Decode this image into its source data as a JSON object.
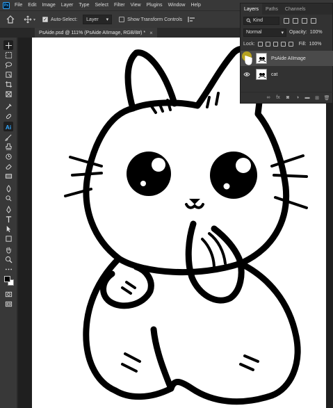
{
  "menubar": {
    "logo": "Ps",
    "items": [
      "File",
      "Edit",
      "Image",
      "Layer",
      "Type",
      "Select",
      "Filter",
      "View",
      "Plugins",
      "Window",
      "Help"
    ]
  },
  "options": {
    "auto_select_label": "Auto-Select:",
    "auto_select_checked": true,
    "target_value": "Layer",
    "transform_label": "Show Transform Controls",
    "transform_checked": false
  },
  "document": {
    "tab_title": "PsAide.psd @ 111% (PsAide AIImage, RGB/8#) *",
    "close_glyph": "×"
  },
  "layers_panel": {
    "tabs": [
      "Layers",
      "Paths",
      "Channels"
    ],
    "active_tab": "Layers",
    "filter_kind": "Kind",
    "blend_mode": "Normal",
    "opacity_label": "Opacity:",
    "opacity_value": "100%",
    "lock_label": "Lock:",
    "fill_label": "Fill:",
    "fill_value": "100%",
    "layers": [
      {
        "name": "PsAide AIImage",
        "visible": false,
        "selected": true
      },
      {
        "name": "cat",
        "visible": true,
        "selected": false
      }
    ],
    "footer_icons": [
      "link-icon",
      "fx-icon",
      "mask-icon",
      "adjustment-icon",
      "folder-icon",
      "new-layer-icon",
      "trash-icon"
    ]
  },
  "toolbar": {
    "tools": [
      "move-tool",
      "marquee-tool",
      "lasso-tool",
      "object-select-tool",
      "crop-tool",
      "frame-tool",
      "eyedropper-tool",
      "healing-tool",
      "ai-tool",
      "brush-tool",
      "stamp-tool",
      "history-brush-tool",
      "eraser-tool",
      "gradient-tool",
      "blur-tool",
      "dodge-tool",
      "pen-tool",
      "type-tool",
      "path-select-tool",
      "shape-tool",
      "hand-tool",
      "zoom-tool",
      "more-tools",
      "swap-colors",
      "quick-mask",
      "screen-mode"
    ],
    "active_tool": "move-tool",
    "foreground": "#000000",
    "background": "#ffffff"
  }
}
